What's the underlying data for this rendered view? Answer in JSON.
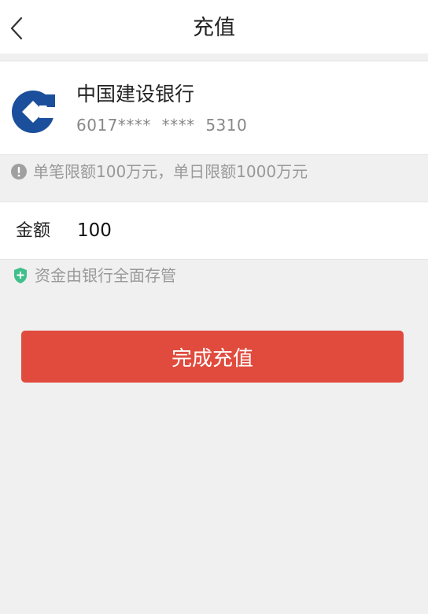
{
  "header": {
    "title": "充值"
  },
  "bank": {
    "name": "中国建设银行",
    "card_number": "6017****  ****  5310",
    "logo_icon": "ccb-bank-logo",
    "logo_color": "#1b4f9c"
  },
  "limit_note": {
    "icon": "exclamation-circle-icon",
    "text": "单笔限额100万元，单日限额1000万元"
  },
  "amount": {
    "label": "金额",
    "value": "100"
  },
  "custody_note": {
    "icon": "shield-plus-icon",
    "text": "资金由银行全面存管"
  },
  "submit": {
    "label": "完成充值",
    "color": "#e04b3e"
  }
}
